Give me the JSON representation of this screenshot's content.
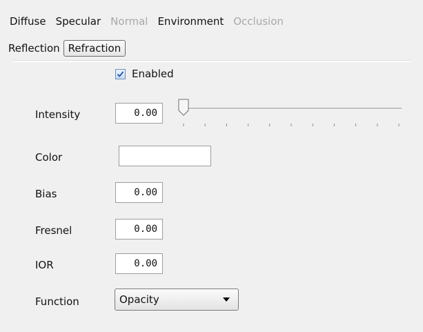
{
  "tabs": {
    "row1": [
      {
        "label": "Diffuse",
        "state": "normal"
      },
      {
        "label": "Specular",
        "state": "normal"
      },
      {
        "label": "Normal",
        "state": "disabled"
      },
      {
        "label": "Environment",
        "state": "normal"
      },
      {
        "label": "Occlusion",
        "state": "disabled"
      }
    ],
    "row2": [
      {
        "label": "Reflection",
        "state": "normal"
      },
      {
        "label": "Refraction",
        "state": "active"
      }
    ]
  },
  "enabled": {
    "label": "Enabled",
    "checked": true
  },
  "fields": {
    "intensity": {
      "label": "Intensity",
      "value": "0.00"
    },
    "color": {
      "label": "Color",
      "value": "#ffffff"
    },
    "bias": {
      "label": "Bias",
      "value": "0.00"
    },
    "fresnel": {
      "label": "Fresnel",
      "value": "0.00"
    },
    "ior": {
      "label": "IOR",
      "value": "0.00"
    },
    "function": {
      "label": "Function",
      "value": "Opacity"
    }
  },
  "slider": {
    "level": 0.0
  },
  "colors": {
    "panel_bg": "#f0f0f0",
    "disabled_text": "#a8a8a8",
    "check_accent": "#2f5da8"
  }
}
